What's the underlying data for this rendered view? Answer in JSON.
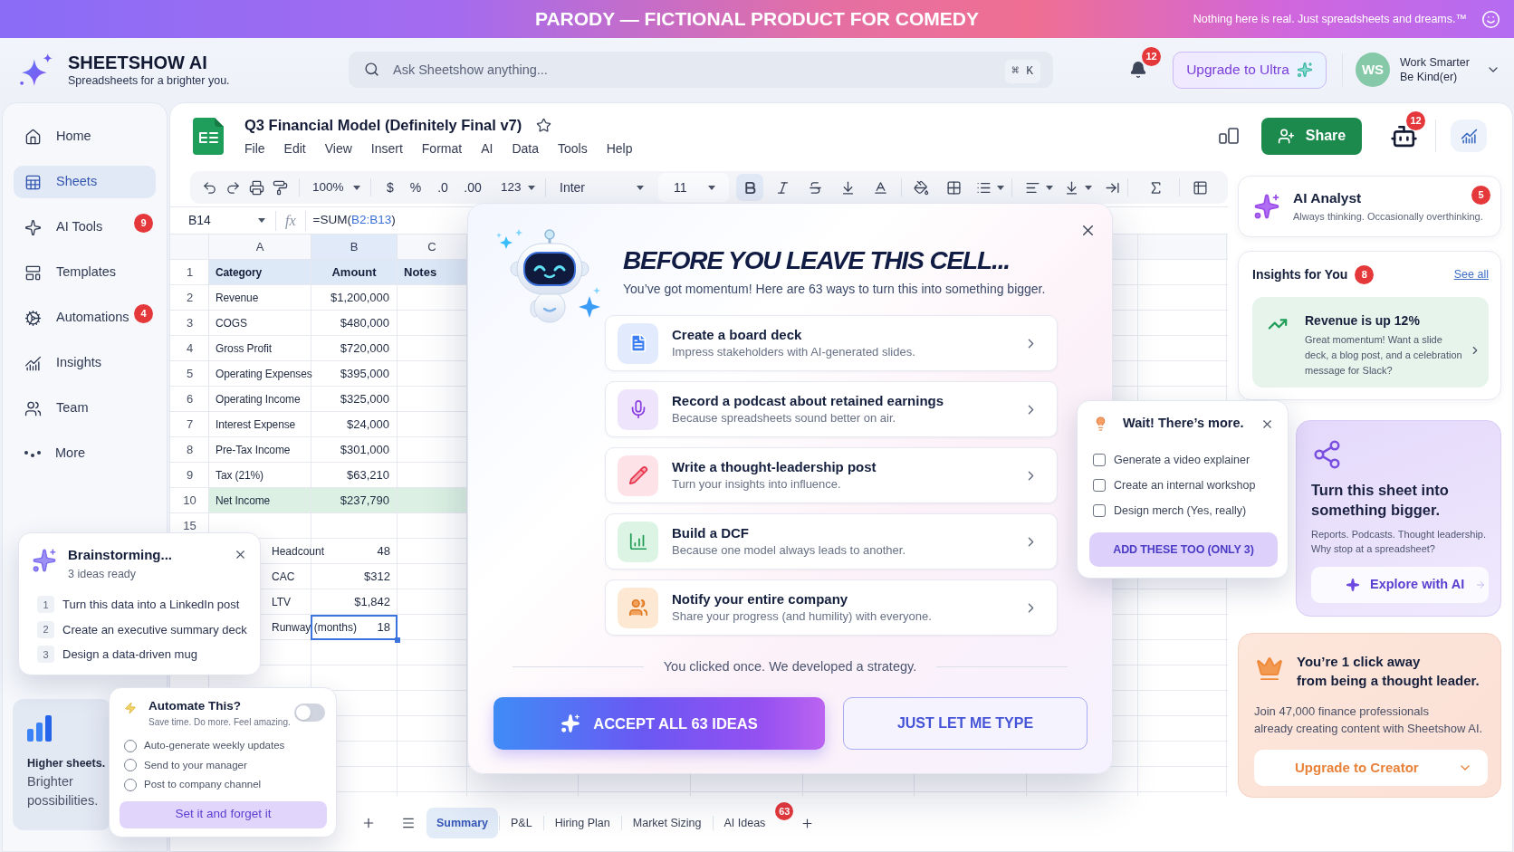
{
  "banner": {
    "title": "PARODY — FICTIONAL PRODUCT FOR COMEDY",
    "tagline": "Nothing here is real. Just spreadsheets and dreams.™"
  },
  "header": {
    "brand": "SHEETSHOW AI",
    "slogan": "Spreadsheets for a brighter you.",
    "search": {
      "placeholder": "Ask Sheetshow anything...",
      "shortcut": "⌘ K"
    },
    "notification_count": "12",
    "upgrade_button": "Upgrade to Ultra",
    "user": {
      "initials": "WS",
      "name": "Work Smarter",
      "status": "Be Kind(er)"
    }
  },
  "sidebar": {
    "items": [
      {
        "kind": "home",
        "label": "Home",
        "selected": false
      },
      {
        "kind": "sheets",
        "label": "Sheets",
        "selected": true
      },
      {
        "kind": "ai",
        "label": "AI Tools",
        "selected": false,
        "badge": "9"
      },
      {
        "kind": "templates",
        "label": "Templates",
        "selected": false
      },
      {
        "kind": "automations",
        "label": "Automations",
        "selected": false,
        "badge": "4"
      },
      {
        "kind": "insights",
        "label": "Insights",
        "selected": false
      },
      {
        "kind": "team",
        "label": "Team",
        "selected": false
      },
      {
        "kind": "more",
        "label": "More",
        "selected": false
      }
    ],
    "promo": {
      "title": "Higher sheets.",
      "text": "Brighter possibilities."
    }
  },
  "document": {
    "title": "Q3 Financial Model (Definitely Final v7)",
    "starred": false,
    "menu": [
      "File",
      "Edit",
      "View",
      "Insert",
      "Format",
      "AI",
      "Data",
      "Tools",
      "Help"
    ],
    "share_button": "Share",
    "assistant_badge": "12"
  },
  "toolbar": {
    "zoom": "100%",
    "number_buttons": [
      "$",
      "%",
      ".0",
      ".00"
    ],
    "number_format": "123",
    "font": "Inter",
    "font_size": "11",
    "format_buttons": [
      {
        "kind": "bold",
        "selected": true
      },
      {
        "kind": "italic",
        "selected": false
      },
      {
        "kind": "strikethrough",
        "selected": false
      },
      {
        "kind": "align_bottom",
        "selected": false
      },
      {
        "kind": "text_color",
        "selected": false
      }
    ]
  },
  "formula_bar": {
    "cell": "B14",
    "label": "fx",
    "formula": [
      {
        "kind": "text",
        "text": "=SUM("
      },
      {
        "kind": "range",
        "text": "B2:B13"
      },
      {
        "kind": "text",
        "text": ")"
      }
    ]
  },
  "grid": {
    "columns": [
      {
        "label": "A",
        "selected": false
      },
      {
        "label": "B",
        "selected": true
      },
      {
        "label": "C",
        "selected": false
      }
    ],
    "rows": [
      {
        "number": "1",
        "kind": "header",
        "cells": [
          "Category",
          "Amount",
          "Notes"
        ]
      },
      {
        "number": "2",
        "kind": "data",
        "cells": [
          "Revenue",
          "$1,200,000"
        ]
      },
      {
        "number": "3",
        "kind": "data",
        "cells": [
          "COGS",
          "$480,000"
        ]
      },
      {
        "number": "4",
        "kind": "data",
        "cells": [
          "Gross Profit",
          "$720,000"
        ]
      },
      {
        "number": "5",
        "kind": "data",
        "cells": [
          "Operating Expenses",
          "$395,000"
        ]
      },
      {
        "number": "6",
        "kind": "data",
        "cells": [
          "Operating Income",
          "$325,000"
        ]
      },
      {
        "number": "7",
        "kind": "data",
        "cells": [
          "Interest Expense",
          "$24,000"
        ]
      },
      {
        "number": "8",
        "kind": "data",
        "cells": [
          "Pre-Tax Income",
          "$301,000"
        ]
      },
      {
        "number": "9",
        "kind": "data",
        "cells": [
          "Tax (21%)",
          "$63,210"
        ]
      },
      {
        "number": "10",
        "kind": "total",
        "cells": [
          "Net Income",
          "$237,790"
        ]
      },
      {
        "number": "15",
        "kind": "data"
      }
    ],
    "metrics": [
      {
        "label": "Headcount",
        "value": "48",
        "selected": false
      },
      {
        "label": "CAC",
        "value": "$312",
        "selected": false
      },
      {
        "label": "LTV",
        "value": "$1,842",
        "selected": false
      },
      {
        "label": "Runway (months)",
        "value": "18",
        "selected": true
      }
    ]
  },
  "sheet_tabs": [
    {
      "label": "Summary",
      "selected": true
    },
    {
      "label": "P&L",
      "selected": false
    },
    {
      "label": "Hiring Plan",
      "selected": false
    },
    {
      "label": "Market Sizing",
      "selected": false
    },
    {
      "label": "AI Ideas",
      "selected": false,
      "badge": "63"
    }
  ],
  "ai_analyst": {
    "title": "AI Analyst",
    "subtitle": "Always thinking. Occasionally overthinking.",
    "badge": "5"
  },
  "insights": {
    "title": "Insights for You",
    "badge": "8",
    "link": "See all",
    "highlight": {
      "title": "Revenue is up 12%",
      "text": "Great momentum! Want a slide deck, a blog post, and a celebration message for Slack?"
    }
  },
  "promo_card": {
    "title": "Turn this sheet into something bigger.",
    "text": "Reports. Podcasts. Thought leadership. Why stop at a spreadsheet?",
    "button": "Explore with AI"
  },
  "creator_card": {
    "title_lines": [
      "You’re 1 click away",
      "from being a thought leader."
    ],
    "text_lines": [
      "Join 47,000 finance professionals",
      "already creating content with Sheetshow AI."
    ],
    "button": "Upgrade to Creator"
  },
  "modal": {
    "title": "BEFORE YOU LEAVE THIS CELL...",
    "subtitle": "You’ve got momentum! Here are 63 ways to turn this into something bigger.",
    "options": [
      {
        "kind": "deck",
        "title": "Create a board deck",
        "text": "Impress stakeholders with AI-generated slides."
      },
      {
        "kind": "podcast",
        "title": "Record a podcast about retained earnings",
        "text": "Because spreadsheets sound better on air."
      },
      {
        "kind": "post",
        "title": "Write a thought-leadership post",
        "text": "Turn your insights into influence."
      },
      {
        "kind": "dcf",
        "title": "Build a DCF",
        "text": "Because one model always leads to another."
      },
      {
        "kind": "notify",
        "title": "Notify your entire company",
        "text": "Share your progress (and humility) with everyone."
      }
    ],
    "footer": "You clicked once. We developed a strategy.",
    "accept_button": "ACCEPT ALL 63 IDEAS",
    "decline_button": "JUST LET ME TYPE"
  },
  "more_popover": {
    "title": "Wait! There’s more.",
    "items": [
      {
        "label": "Generate a video explainer",
        "checked": false
      },
      {
        "label": "Create an internal workshop",
        "checked": false
      },
      {
        "label": "Design merch (Yes, really)",
        "checked": false
      }
    ],
    "button": "ADD THESE TOO (ONLY 3)"
  },
  "brainstorm_popover": {
    "title": "Brainstorming...",
    "subtitle": "3 ideas ready",
    "ideas": [
      {
        "number": "1",
        "text": "Turn this data into a LinkedIn post"
      },
      {
        "number": "2",
        "text": "Create an executive summary deck"
      },
      {
        "number": "3",
        "text": "Design a data-driven mug"
      }
    ]
  },
  "automate_popover": {
    "title": "Automate This?",
    "subtitle": "Save time. Do more. Feel amazing.",
    "on": false,
    "options": [
      {
        "label": "Auto-generate weekly updates",
        "selected": false
      },
      {
        "label": "Send to your manager",
        "selected": false
      },
      {
        "label": "Post to company channel",
        "selected": false
      }
    ],
    "button": "Set it and forget it"
  }
}
